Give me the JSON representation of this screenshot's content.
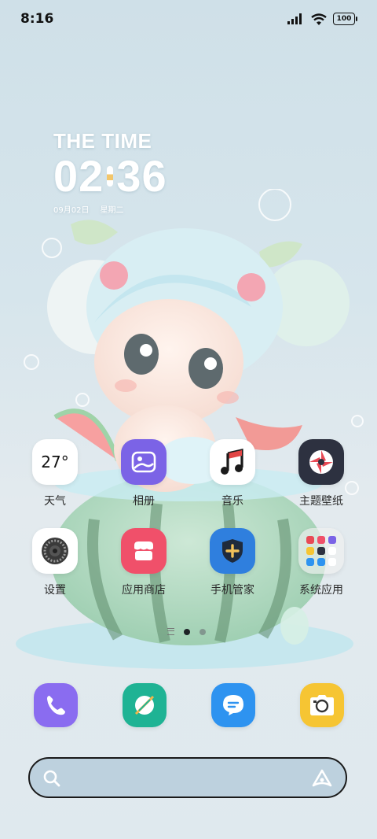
{
  "status_bar": {
    "time": "8:16",
    "battery": "100",
    "icons": [
      "signal-icon",
      "wifi-icon",
      "battery-icon"
    ]
  },
  "clock_widget": {
    "label": "THE TIME",
    "hours": "02",
    "minutes": "36",
    "date": "09月02日",
    "weekday": "星期二"
  },
  "apps": [
    {
      "name": "天气",
      "icon": "weather-icon",
      "value": "27°"
    },
    {
      "name": "相册",
      "icon": "gallery-icon"
    },
    {
      "name": "音乐",
      "icon": "music-icon"
    },
    {
      "name": "主题壁纸",
      "icon": "theme-wallpaper-icon"
    },
    {
      "name": "设置",
      "icon": "settings-icon"
    },
    {
      "name": "应用商店",
      "icon": "app-store-icon"
    },
    {
      "name": "手机管家",
      "icon": "phone-manager-icon"
    },
    {
      "name": "系统应用",
      "icon": "system-apps-folder-icon"
    }
  ],
  "dock": [
    {
      "icon": "phone-icon"
    },
    {
      "icon": "browser-icon"
    },
    {
      "icon": "messages-icon"
    },
    {
      "icon": "camera-icon"
    }
  ],
  "page_indicator": {
    "pages": 2,
    "current": 1
  },
  "colors": {
    "gallery": "#7b63e6",
    "theme": "#2d3140",
    "store": "#f0506a",
    "manager": "#2f7fde",
    "phone": "#8a6cf0",
    "browser": "#1fb394",
    "messages": "#2e93f0",
    "camera": "#f6c533"
  }
}
